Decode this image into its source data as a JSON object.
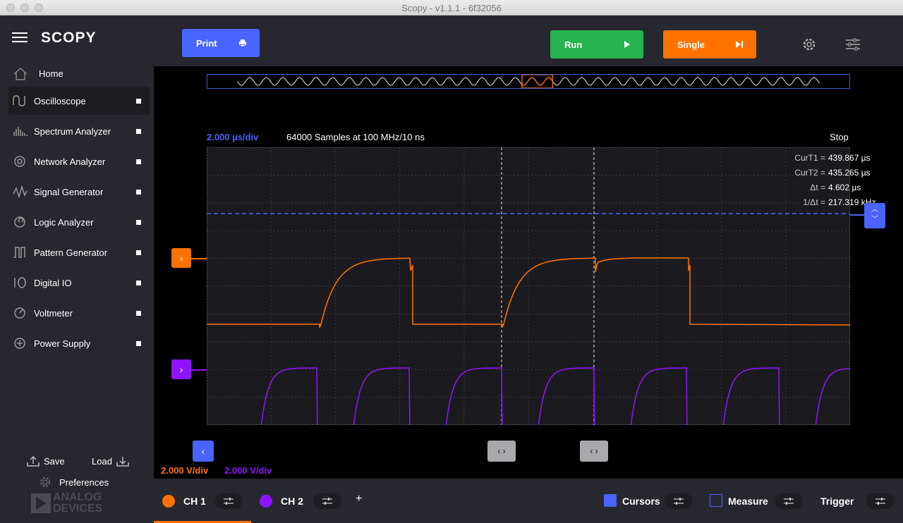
{
  "window": {
    "title": "Scopy - v1.1.1 - 6f32056"
  },
  "sidebar": {
    "logo": "SCOPY",
    "home": "Home",
    "items": [
      {
        "label": "Oscilloscope",
        "icon": "oscilloscope-icon",
        "active": true
      },
      {
        "label": "Spectrum Analyzer",
        "icon": "spectrum-icon"
      },
      {
        "label": "Network Analyzer",
        "icon": "network-icon"
      },
      {
        "label": "Signal Generator",
        "icon": "signal-icon"
      },
      {
        "label": "Logic Analyzer",
        "icon": "logic-icon"
      },
      {
        "label": "Pattern Generator",
        "icon": "pattern-icon"
      },
      {
        "label": "Digital IO",
        "icon": "digital-io-icon"
      },
      {
        "label": "Voltmeter",
        "icon": "voltmeter-icon"
      },
      {
        "label": "Power Supply",
        "icon": "power-icon"
      }
    ],
    "save": "Save",
    "load": "Load",
    "preferences": "Preferences",
    "brand_line1": "ANALOG",
    "brand_line2": "DEVICES"
  },
  "toolbar": {
    "print": "Print",
    "run": "Run",
    "single": "Single"
  },
  "scope": {
    "timebase": "2.000 µs/div",
    "samples": "64000 Samples at 100 MHz/10 ns",
    "status": "Stop",
    "measurements": [
      {
        "label": "CurT1 =",
        "value": "439.867 µs"
      },
      {
        "label": "CurT2 =",
        "value": "435.265 µs"
      },
      {
        "label": "Δt =",
        "value": "4.602 µs"
      },
      {
        "label": "1/Δt =",
        "value": "217.319 kHz"
      }
    ],
    "ch1_vdiv": "2.000 V/div",
    "ch2_vdiv": "2.000 V/div"
  },
  "bottom": {
    "ch1": "CH 1",
    "ch2": "CH 2",
    "add": "+",
    "cursors": "Cursors",
    "measure": "Measure",
    "trigger": "Trigger"
  },
  "colors": {
    "ch1": "#ff7200",
    "ch2": "#9013fe",
    "accent": "#4a64ff",
    "run": "#27b34f",
    "single": "#ff7200"
  }
}
